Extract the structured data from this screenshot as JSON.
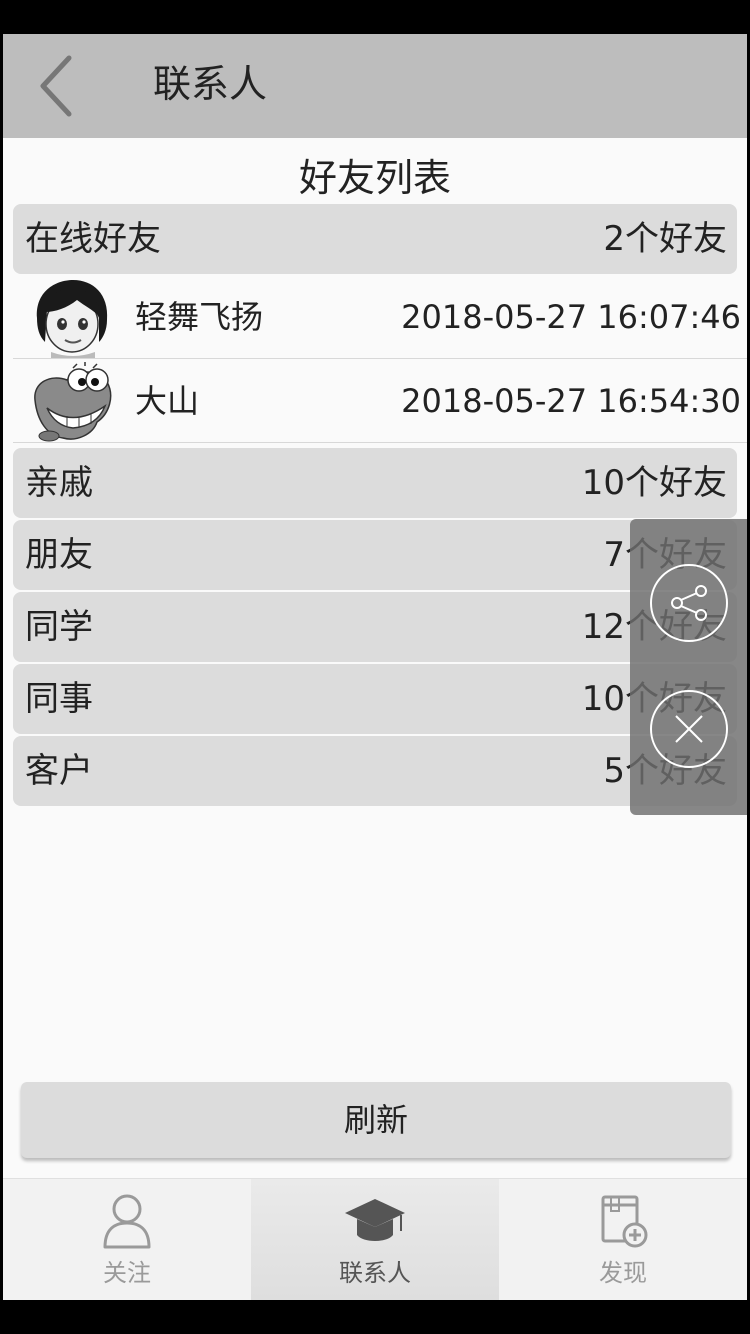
{
  "header": {
    "title": "联系人",
    "back_icon": "chevron-left-icon"
  },
  "list_title": "好友列表",
  "groups": [
    {
      "name": "在线好友",
      "count": "2个好友"
    },
    {
      "name": "亲戚",
      "count": "10个好友"
    },
    {
      "name": "朋友",
      "count": "7个好友"
    },
    {
      "name": "同学",
      "count": "12个好友"
    },
    {
      "name": "同事",
      "count": "10个好友"
    },
    {
      "name": "客户",
      "count": "5个好友"
    }
  ],
  "friends": [
    {
      "name": "轻舞飞扬",
      "time": "2018-05-27 16:07:46",
      "avatar": "girl-avatar-icon"
    },
    {
      "name": "大山",
      "time": "2018-05-27 16:54:30",
      "avatar": "cartoon-avatar-icon"
    }
  ],
  "refresh_label": "刷新",
  "tabs": [
    {
      "label": "关注",
      "icon": "user-icon",
      "active": false
    },
    {
      "label": "联系人",
      "icon": "graduation-cap-icon",
      "active": true
    },
    {
      "label": "发现",
      "icon": "add-note-icon",
      "active": false
    }
  ],
  "float_panel": {
    "buttons": [
      "share-icon",
      "close-icon"
    ]
  }
}
